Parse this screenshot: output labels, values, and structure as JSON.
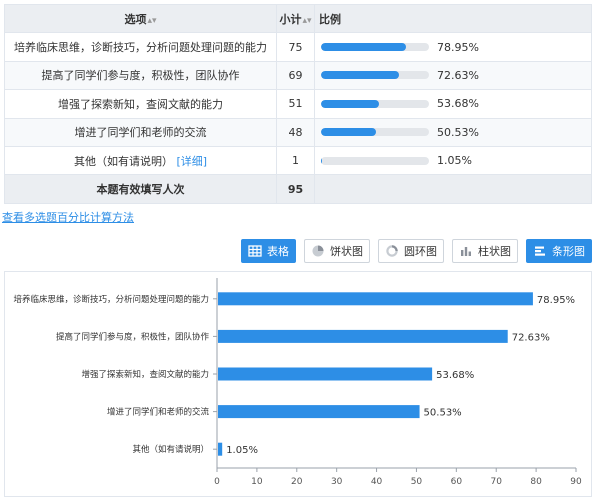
{
  "table": {
    "headers": {
      "option": "选项",
      "count": "小计",
      "percent": "比例"
    },
    "rows": [
      {
        "option": "培养临床思维，诊断技巧，分析问题处理问题的能力",
        "count": "75",
        "percent": "78.95%",
        "value": 78.95
      },
      {
        "option": "提高了同学们参与度，积极性，团队协作",
        "count": "69",
        "percent": "72.63%",
        "value": 72.63
      },
      {
        "option": "增强了探索新知，查阅文献的能力",
        "count": "51",
        "percent": "53.68%",
        "value": 53.68
      },
      {
        "option": "增进了同学们和老师的交流",
        "count": "48",
        "percent": "50.53%",
        "value": 50.53
      },
      {
        "option": "其他（如有请说明）",
        "detail": "[详细]",
        "count": "1",
        "percent": "1.05%",
        "value": 1.05
      }
    ],
    "total": {
      "label": "本题有效填写人次",
      "count": "95"
    }
  },
  "calc_link": "查看多选题百分比计算方法",
  "toolbar": {
    "table": "表格",
    "pie": "饼状图",
    "donut": "圆环图",
    "column": "柱状图",
    "bar": "条形图"
  },
  "colors": {
    "accent": "#2d8ee6",
    "track": "#e3e6ea"
  },
  "chart_data": {
    "type": "bar",
    "orientation": "horizontal",
    "categories": [
      "培养临床思维，诊断技巧，分析问题处理问题的能力",
      "提高了同学们参与度，积极性，团队协作",
      "增强了探索新知，查阅文献的能力",
      "增进了同学们和老师的交流",
      "其他（如有请说明）"
    ],
    "values": [
      78.95,
      72.63,
      53.68,
      50.53,
      1.05
    ],
    "value_labels": [
      "78.95%",
      "72.63%",
      "53.68%",
      "50.53%",
      "1.05%"
    ],
    "xlim": [
      0,
      90
    ],
    "xticks": [
      0,
      10,
      20,
      30,
      40,
      50,
      60,
      70,
      80,
      90
    ],
    "grid": false,
    "legend": "none"
  }
}
